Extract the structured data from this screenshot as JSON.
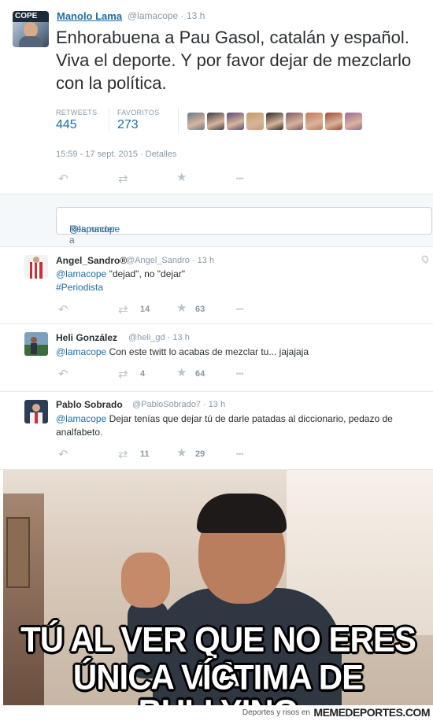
{
  "main_tweet": {
    "name": "Manolo Lama",
    "handle": "@lamacope",
    "time": "· 13 h",
    "avatar_badge": "COPE",
    "text": "Enhorabuena a Pau Gasol, catalán y español. Viva el deporte. Y por favor dejar de mezclarlo con la política.",
    "retweets_label": "RETWEETS",
    "retweets": "445",
    "favorites_label": "FAVORITOS",
    "favorites": "273",
    "date": "15:59 - 17 sept. 2015 ·",
    "details_label": "Detalles",
    "favoriter_avatar_colors": [
      "#6b7a8a",
      "#3a3f4a",
      "#5a4a7a",
      "#c49a6c",
      "#2b2b2b",
      "#7a5a6a",
      "#c27a5a",
      "#a04a3a",
      "#9a6a9a"
    ]
  },
  "reply_box": {
    "prefix": "Responder a",
    "mention": "@lamacope"
  },
  "replies": [
    {
      "name": "Angel_Sandro®",
      "handle": "@Angel_Sandro",
      "time": "· 13 h",
      "mention": "@lamacope",
      "text": "\"dejad\", no \"dejar\"",
      "hashtag": "#Periodista",
      "retweets": "14",
      "favorites": "63",
      "avatar_color": "#c8303a"
    },
    {
      "name": "Heli González",
      "handle": "@heli_gd",
      "time": "· 13 h",
      "mention": "@lamacope",
      "text": "Con este twitt lo acabas de mezclar tu... jajajaja",
      "retweets": "4",
      "favorites": "64",
      "avatar_color": "#3d6b3a"
    },
    {
      "name": "Pablo Sobrado",
      "handle": "@PabloSobrado7",
      "time": "· 13 h",
      "mention": "@lamacope",
      "text": "Dejar tenías que dejar tú de darle patadas al diccionario, pedazo de analfabeto.",
      "retweets": "11",
      "favorites": "29",
      "avatar_color": "#2c3e55"
    }
  ],
  "meme": {
    "caption_line1": "TÚ AL VER QUE NO ERES LA",
    "caption_line2": "ÚNICA VÍCTIMA DE BULLYING"
  },
  "footer": {
    "text": "Deportes y risos en",
    "site": "MEMEDEPORTES.COM"
  },
  "icons": {
    "reply": "↶",
    "retweet": "⇄",
    "favorite": "★",
    "more": "•••"
  }
}
